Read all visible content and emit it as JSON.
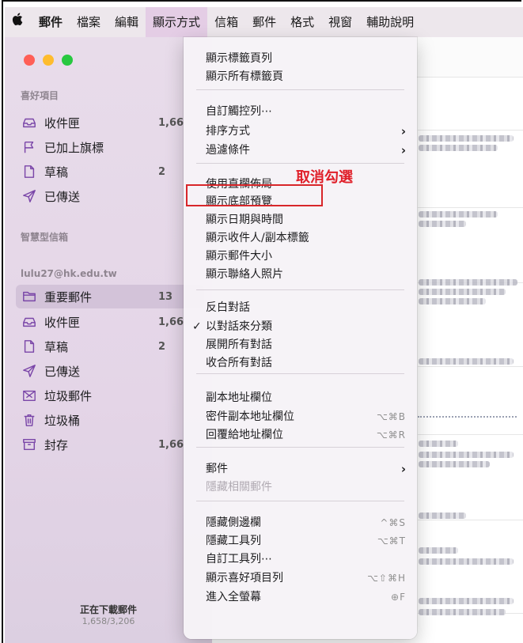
{
  "menubar": {
    "items": [
      "郵件",
      "檔案",
      "編輯",
      "顯示方式",
      "信箱",
      "郵件",
      "格式",
      "視窗",
      "輔助說明"
    ],
    "active_index": 3
  },
  "sidebar": {
    "favorites_header": "喜好項目",
    "favorites": [
      {
        "label": "收件匣",
        "count": "1,66",
        "icon": "tray-icon"
      },
      {
        "label": "已加上旗標",
        "count": "",
        "icon": "flag-icon"
      },
      {
        "label": "草稿",
        "count": "2",
        "icon": "document-icon"
      },
      {
        "label": "已傳送",
        "count": "",
        "icon": "paperplane-icon"
      }
    ],
    "smart_header": "智慧型信箱",
    "account_header": "lulu27@hk.edu.tw",
    "account_items": [
      {
        "label": "重要郵件",
        "count": "13",
        "icon": "folder-icon",
        "selected": true
      },
      {
        "label": "收件匣",
        "count": "1,66",
        "icon": "tray-icon"
      },
      {
        "label": "草稿",
        "count": "2",
        "icon": "document-icon"
      },
      {
        "label": "已傳送",
        "count": "",
        "icon": "paperplane-icon"
      },
      {
        "label": "垃圾郵件",
        "count": "",
        "icon": "junk-icon"
      },
      {
        "label": "垃圾桶",
        "count": "",
        "icon": "trash-icon"
      },
      {
        "label": "封存",
        "count": "1,66",
        "icon": "archive-icon"
      }
    ],
    "status": "正在下載郵件",
    "progress": "1,658/3,206"
  },
  "menu": {
    "groups": [
      [
        {
          "label": "顯示標籤頁列"
        },
        {
          "label": "顯示所有標籤頁"
        }
      ],
      [
        {
          "label": "自訂觸控列⋯"
        },
        {
          "label": "排序方式",
          "submenu": true
        },
        {
          "label": "過濾條件",
          "submenu": true
        }
      ],
      [
        {
          "label": "使用直欄佈局"
        },
        {
          "label": "顯示底部預覽"
        },
        {
          "label": "顯示日期與時間"
        },
        {
          "label": "顯示收件人/副本標籤"
        },
        {
          "label": "顯示郵件大小"
        },
        {
          "label": "顯示聯絡人照片"
        }
      ],
      [
        {
          "label": "反白對話"
        },
        {
          "label": "以對話來分類",
          "checked": true
        },
        {
          "label": "展開所有對話"
        },
        {
          "label": "收合所有對話"
        }
      ],
      [
        {
          "label": "副本地址欄位"
        },
        {
          "label": "密件副本地址欄位",
          "shortcut": "⌥⌘B"
        },
        {
          "label": "回覆給地址欄位",
          "shortcut": "⌥⌘R"
        }
      ],
      [
        {
          "label": "郵件",
          "submenu": true
        },
        {
          "label": "隱藏相關郵件",
          "disabled": true
        }
      ],
      [
        {
          "label": "隱藏側邊欄",
          "shortcut": "^⌘S"
        },
        {
          "label": "隱藏工具列",
          "shortcut": "⌥⌘T"
        },
        {
          "label": "自訂工具列⋯"
        },
        {
          "label": "顯示喜好項目列",
          "shortcut": "⌥⇧⌘H"
        },
        {
          "label": "進入全螢幕",
          "shortcut": "⊕F"
        }
      ]
    ]
  },
  "annotation": {
    "text": "取消勾選",
    "color": "#e0202a"
  }
}
